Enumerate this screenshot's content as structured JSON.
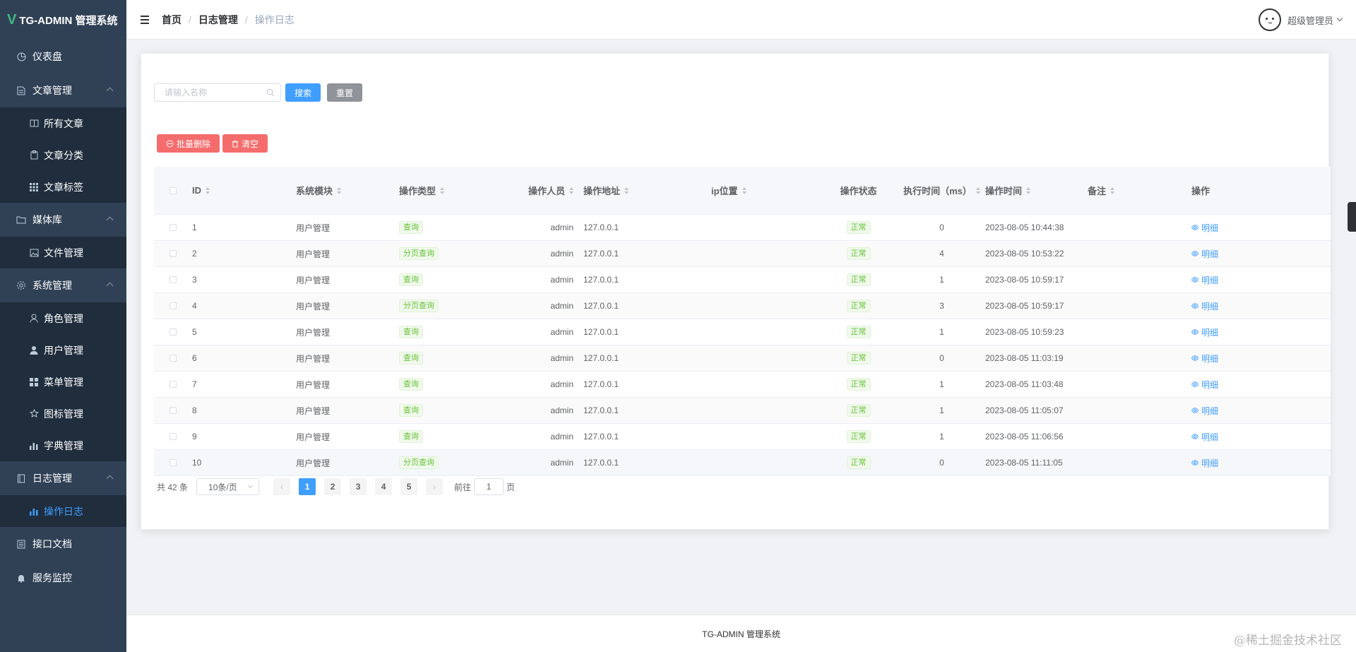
{
  "app": {
    "logo_letter": "V",
    "title": "TG-ADMIN 管理系统"
  },
  "sidebar": {
    "items": [
      {
        "label": "仪表盘",
        "icon": "dashboard-icon"
      },
      {
        "label": "文章管理",
        "icon": "document-icon",
        "expanded": true,
        "children": [
          {
            "label": "所有文章",
            "icon": "book-icon"
          },
          {
            "label": "文章分类",
            "icon": "clipboard-icon"
          },
          {
            "label": "文章标签",
            "icon": "grid-icon"
          }
        ]
      },
      {
        "label": "媒体库",
        "icon": "folder-icon",
        "expanded": true,
        "children": [
          {
            "label": "文件管理",
            "icon": "picture-icon"
          }
        ]
      },
      {
        "label": "系统管理",
        "icon": "gear-icon",
        "expanded": true,
        "children": [
          {
            "label": "角色管理",
            "icon": "user-outline-icon"
          },
          {
            "label": "用户管理",
            "icon": "user-solid-icon"
          },
          {
            "label": "菜单管理",
            "icon": "menu-grid-icon"
          },
          {
            "label": "图标管理",
            "icon": "star-icon"
          },
          {
            "label": "字典管理",
            "icon": "bar-chart-icon"
          }
        ]
      },
      {
        "label": "日志管理",
        "icon": "notebook-icon",
        "expanded": true,
        "children": [
          {
            "label": "操作日志",
            "icon": "bar-chart-icon",
            "active": true
          }
        ]
      },
      {
        "label": "接口文档",
        "icon": "tickets-icon"
      },
      {
        "label": "服务监控",
        "icon": "bell-icon"
      }
    ]
  },
  "header": {
    "breadcrumb": [
      "首页",
      "日志管理",
      "操作日志"
    ],
    "separator": "/",
    "user_name": "超级管理员"
  },
  "search": {
    "placeholder": "请输入名称",
    "value": "",
    "search_label": "搜索",
    "reset_label": "重置"
  },
  "actions": {
    "batch_delete_label": "批量删除",
    "clear_label": "清空"
  },
  "table": {
    "columns": [
      "ID",
      "系统模块",
      "操作类型",
      "操作人员",
      "操作地址",
      "ip位置",
      "操作状态",
      "执行时间（ms）",
      "操作时间",
      "备注",
      "操作"
    ],
    "sortable": [
      true,
      true,
      true,
      true,
      true,
      true,
      false,
      true,
      true,
      true,
      false
    ],
    "rows": [
      {
        "id": "1",
        "module": "用户管理",
        "type": "查询",
        "operator": "admin",
        "address": "127.0.0.1",
        "ip_location": "",
        "status": "正常",
        "cost": "0",
        "time": "2023-08-05 10:44:38",
        "remark": "",
        "action": "明细"
      },
      {
        "id": "2",
        "module": "用户管理",
        "type": "分页查询",
        "operator": "admin",
        "address": "127.0.0.1",
        "ip_location": "",
        "status": "正常",
        "cost": "4",
        "time": "2023-08-05 10:53:22",
        "remark": "",
        "action": "明细"
      },
      {
        "id": "3",
        "module": "用户管理",
        "type": "查询",
        "operator": "admin",
        "address": "127.0.0.1",
        "ip_location": "",
        "status": "正常",
        "cost": "1",
        "time": "2023-08-05 10:59:17",
        "remark": "",
        "action": "明细"
      },
      {
        "id": "4",
        "module": "用户管理",
        "type": "分页查询",
        "operator": "admin",
        "address": "127.0.0.1",
        "ip_location": "",
        "status": "正常",
        "cost": "3",
        "time": "2023-08-05 10:59:17",
        "remark": "",
        "action": "明细"
      },
      {
        "id": "5",
        "module": "用户管理",
        "type": "查询",
        "operator": "admin",
        "address": "127.0.0.1",
        "ip_location": "",
        "status": "正常",
        "cost": "1",
        "time": "2023-08-05 10:59:23",
        "remark": "",
        "action": "明细"
      },
      {
        "id": "6",
        "module": "用户管理",
        "type": "查询",
        "operator": "admin",
        "address": "127.0.0.1",
        "ip_location": "",
        "status": "正常",
        "cost": "0",
        "time": "2023-08-05 11:03:19",
        "remark": "",
        "action": "明细"
      },
      {
        "id": "7",
        "module": "用户管理",
        "type": "查询",
        "operator": "admin",
        "address": "127.0.0.1",
        "ip_location": "",
        "status": "正常",
        "cost": "1",
        "time": "2023-08-05 11:03:48",
        "remark": "",
        "action": "明细"
      },
      {
        "id": "8",
        "module": "用户管理",
        "type": "查询",
        "operator": "admin",
        "address": "127.0.0.1",
        "ip_location": "",
        "status": "正常",
        "cost": "1",
        "time": "2023-08-05 11:05:07",
        "remark": "",
        "action": "明细"
      },
      {
        "id": "9",
        "module": "用户管理",
        "type": "查询",
        "operator": "admin",
        "address": "127.0.0.1",
        "ip_location": "",
        "status": "正常",
        "cost": "1",
        "time": "2023-08-05 11:06:56",
        "remark": "",
        "action": "明细"
      },
      {
        "id": "10",
        "module": "用户管理",
        "type": "分页查询",
        "operator": "admin",
        "address": "127.0.0.1",
        "ip_location": "",
        "status": "正常",
        "cost": "0",
        "time": "2023-08-05 11:11:05",
        "remark": "",
        "action": "明细"
      }
    ]
  },
  "pagination": {
    "total_text": "共 42 条",
    "page_size": "10条/页",
    "pages": [
      "1",
      "2",
      "3",
      "4",
      "5"
    ],
    "current": "1",
    "prev": "‹",
    "next": "›",
    "goto_prefix": "前往",
    "goto_value": "1",
    "goto_suffix": "页"
  },
  "footer": {
    "text": "TG-ADMIN 管理系统"
  },
  "watermark": "@稀土掘金技术社区",
  "colors": {
    "sidebar_bg": "#304156",
    "primary": "#409eff",
    "danger": "#f56c6c",
    "success": "#67c23a",
    "info": "#909399"
  }
}
